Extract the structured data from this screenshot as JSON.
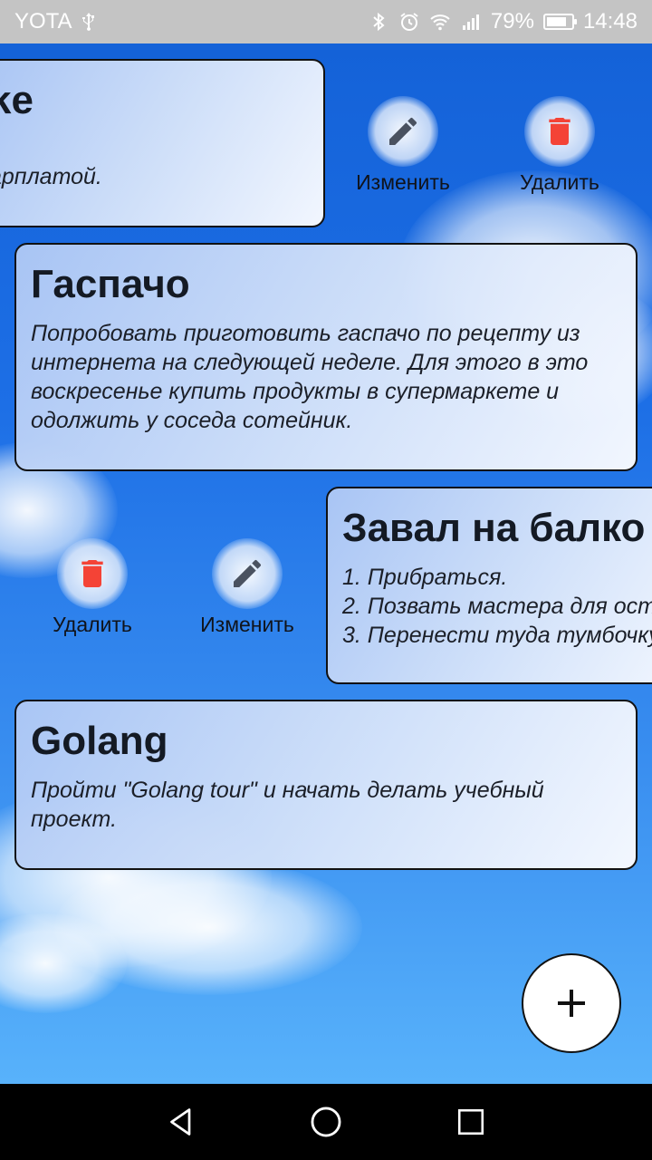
{
  "status_bar": {
    "carrier": "YOTA",
    "battery_percent": "79%",
    "battery_level": 0.79,
    "time": "14:48",
    "icons": [
      "usb-icon",
      "bluetooth-icon",
      "alarm-icon",
      "wifi-icon",
      "signal-icon",
      "battery-icon"
    ]
  },
  "cards": [
    {
      "title": "ke",
      "body": [
        "арплатой."
      ]
    },
    {
      "title": "Гаспачо",
      "body": [
        "Попробовать приготовить гаспачо по рецепту из",
        "интернета на следующей неделе. Для этого в это",
        "воскресенье купить продукты в супермаркете и",
        "одолжить у соседа сотейник."
      ]
    },
    {
      "title": "Завал на балко",
      "body": [
        "1. Прибраться.",
        "2. Позвать мастера для ост",
        "3. Перенести туда тумбочку"
      ]
    },
    {
      "title": "Golang",
      "body": [
        "Пройти \"Golang tour\" и начать делать учебный",
        "проект."
      ]
    }
  ],
  "actions": {
    "edit_label": "Изменить",
    "delete_label": "Удалить"
  },
  "colors": {
    "delete_icon": "#f44336",
    "edit_icon": "#4a5260",
    "card_border": "#111111"
  },
  "fab": {
    "icon": "plus-icon"
  },
  "nav_bar": {
    "icons": [
      "back-icon",
      "home-icon",
      "recents-icon"
    ]
  }
}
